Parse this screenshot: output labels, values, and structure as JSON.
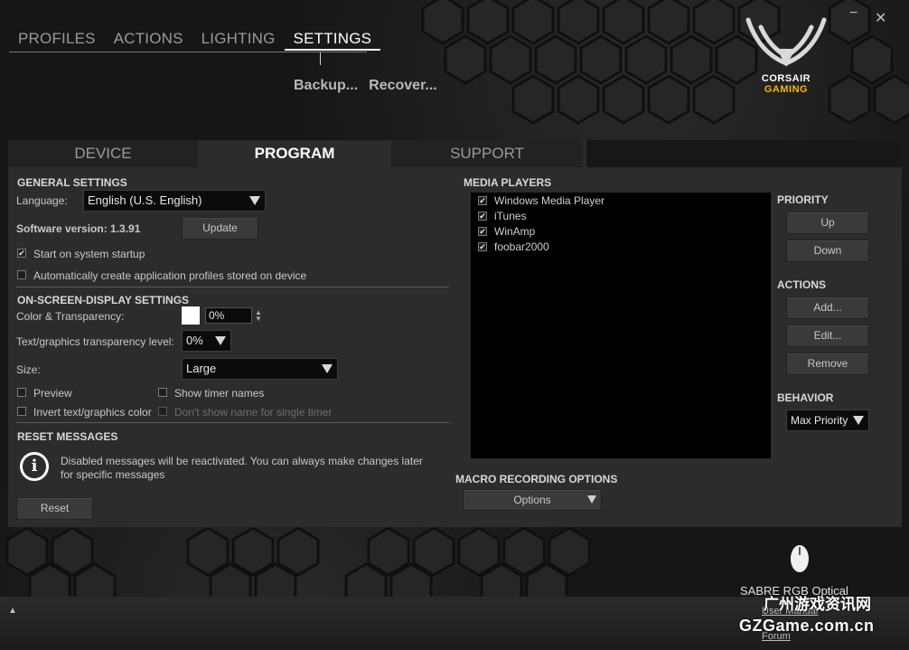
{
  "topnav": {
    "items": [
      {
        "label": "PROFILES"
      },
      {
        "label": "ACTIONS"
      },
      {
        "label": "LIGHTING"
      },
      {
        "label": "SETTINGS",
        "active": true
      }
    ]
  },
  "subnav": {
    "backup": "Backup...",
    "recover": "Recover..."
  },
  "window": {
    "minimize": "−",
    "close": "✕"
  },
  "logo": {
    "line1": "CORSAIR",
    "line2": "GAMING",
    "color_white": "#ffffff",
    "color_gold": "#f2b800"
  },
  "tabs": [
    {
      "label": "DEVICE"
    },
    {
      "label": "PROGRAM",
      "active": true
    },
    {
      "label": "SUPPORT"
    }
  ],
  "general": {
    "title": "GENERAL SETTINGS",
    "language_label": "Language:",
    "language_value": "English (U.S. English)",
    "version": "Software version: 1.3.91",
    "update_button": "Update",
    "startup": {
      "label": "Start on system startup",
      "checked": true
    },
    "auto_profiles": {
      "label": "Automatically create application profiles stored on device",
      "checked": false
    }
  },
  "osd": {
    "title": "ON-SCREEN-DISPLAY SETTINGS",
    "color_label": "Color & Transparency:",
    "color_value": "0%",
    "color_swatch": "#ffffff",
    "tgt_label": "Text/graphics transparency level:",
    "tgt_value": "0%",
    "size_label": "Size:",
    "size_value": "Large",
    "preview": {
      "label": "Preview",
      "checked": false
    },
    "show_timer": {
      "label": "Show timer names",
      "checked": false
    },
    "invert": {
      "label": "Invert text/graphics color",
      "checked": false
    },
    "dont_show": {
      "label": "Don't show name for single timer",
      "checked": false
    }
  },
  "reset": {
    "title": "RESET MESSAGES",
    "text_line1": "Disabled messages will be reactivated. You can always make changes later",
    "text_line2": "for specific messages",
    "button": "Reset",
    "info_glyph": "i"
  },
  "media": {
    "title": "MEDIA PLAYERS",
    "players": [
      {
        "name": "Windows Media Player",
        "checked": true
      },
      {
        "name": "iTunes",
        "checked": true
      },
      {
        "name": "WinAmp",
        "checked": true
      },
      {
        "name": "foobar2000",
        "checked": true
      }
    ]
  },
  "priority": {
    "title": "PRIORITY",
    "up": "Up",
    "down": "Down"
  },
  "actions": {
    "title": "ACTIONS",
    "add": "Add...",
    "edit": "Edit...",
    "remove": "Remove"
  },
  "behavior": {
    "title": "BEHAVIOR",
    "value": "Max Priority"
  },
  "macro": {
    "title": "MACRO RECORDING OPTIONS",
    "button": "Options"
  },
  "footer": {
    "device_name": "SABRE RGB Optical",
    "user_manual": "User Manual",
    "forum": "Forum",
    "watermark_cn": "广州游戏资讯网",
    "watermark_en": "GZGame.com.cn"
  },
  "check_glyph": "✔"
}
